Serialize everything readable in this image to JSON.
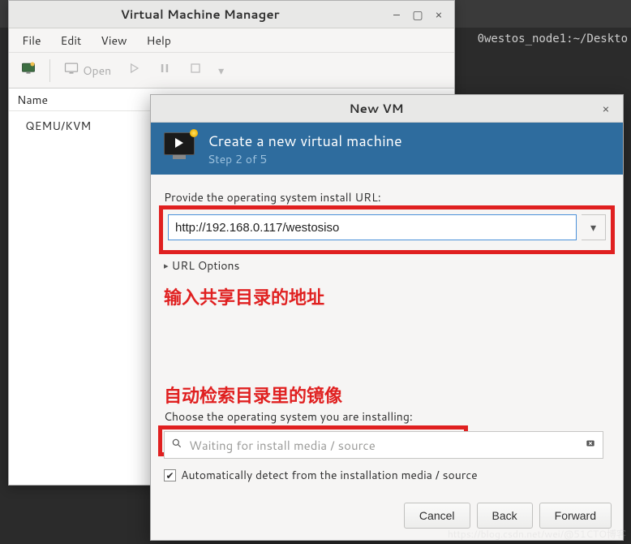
{
  "bg_terminal": "0westos_node1:~/Deskto",
  "main_window": {
    "title": "Virtual Machine Manager",
    "menus": [
      "File",
      "Edit",
      "View",
      "Help"
    ],
    "toolbar": {
      "open_label": "Open"
    },
    "list": {
      "header": "Name",
      "rows": [
        "QEMU/KVM"
      ]
    }
  },
  "dialog": {
    "title": "New VM",
    "heading": "Create a new virtual machine",
    "step": "Step 2 of 5",
    "url_label": "Provide the operating system install URL:",
    "url_value": "http://192.168.0.117/westosiso",
    "url_options_label": "URL Options",
    "annotation1": "输入共享目录的地址",
    "annotation2": "自动检索目录里的镜像",
    "os_label": "Choose the operating system you are installing:",
    "os_placeholder": "Waiting for install media / source",
    "autodetect_label": "Automatically detect from the installation media / source",
    "autodetect_checked": true,
    "buttons": {
      "cancel": "Cancel",
      "back": "Back",
      "forward": "Forward"
    }
  },
  "watermark": "https://blog.csdn.net/wei/@51CTO博客"
}
